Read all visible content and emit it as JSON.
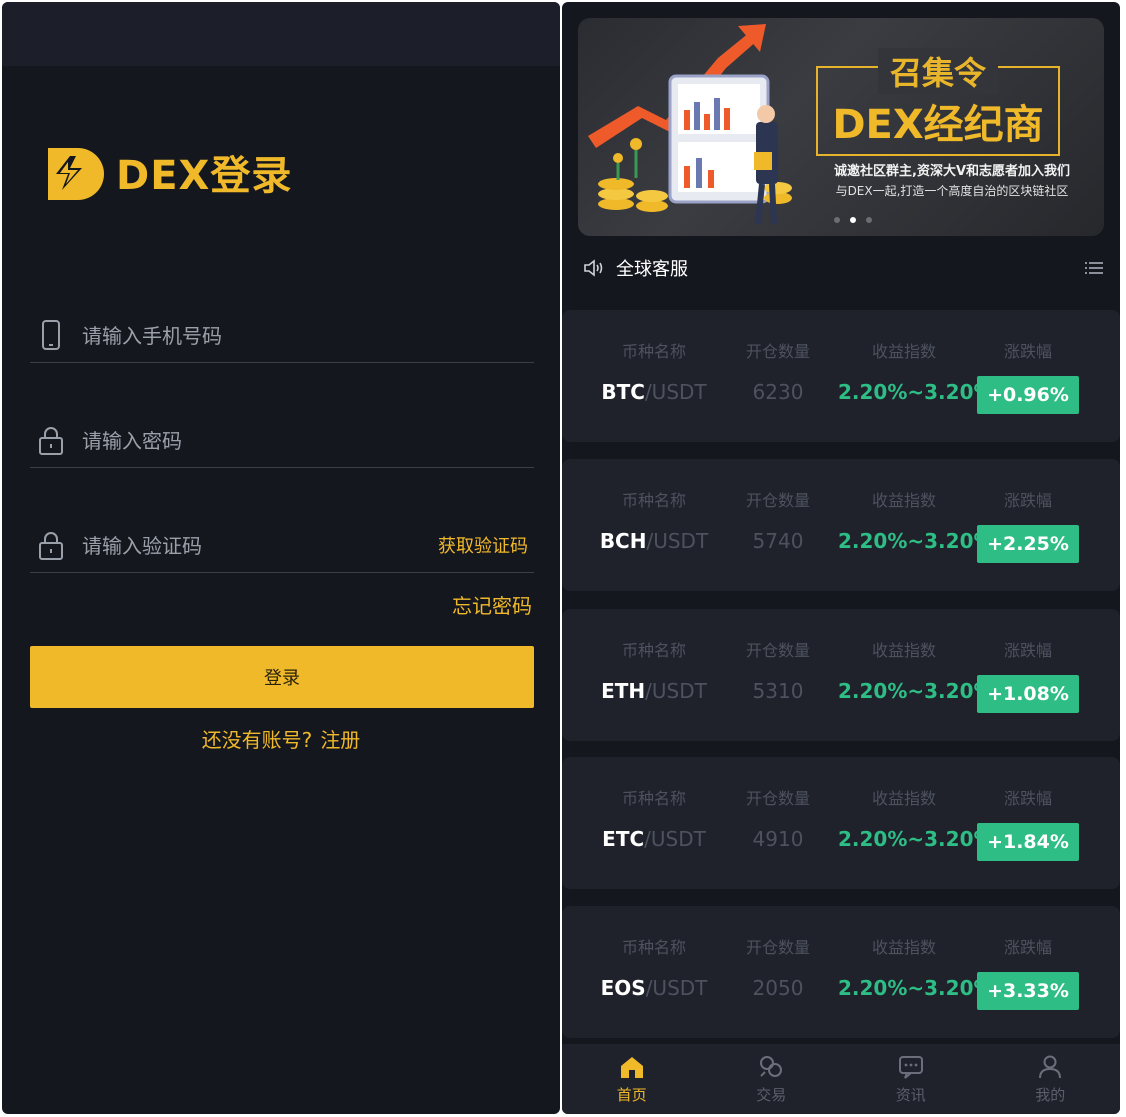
{
  "login": {
    "logo_text": "DEX登录",
    "phone_placeholder": "请输入手机号码",
    "password_placeholder": "请输入密码",
    "code_placeholder": "请输入验证码",
    "get_code": "获取验证码",
    "forgot_password": "忘记密码",
    "login_button": "登录",
    "no_account": "还没有账号?",
    "register": "注册"
  },
  "home": {
    "banner": {
      "title": "召集令",
      "main": "DEX经纪商",
      "sub1": "诚邀社区群主,资深大V和志愿者加入我们",
      "sub2": "与DEX一起,打造一个高度自治的区块链社区",
      "active_dot": 1
    },
    "notice": "全球客服",
    "headers": [
      "币种名称",
      "开仓数量",
      "收益指数",
      "涨跌幅"
    ],
    "markets": [
      {
        "base": "BTC",
        "quote": "/USDT",
        "qty": "6230",
        "range": "2.20%~3.20%",
        "change": "+0.96%"
      },
      {
        "base": "BCH",
        "quote": "/USDT",
        "qty": "5740",
        "range": "2.20%~3.20%",
        "change": "+2.25%"
      },
      {
        "base": "ETH",
        "quote": "/USDT",
        "qty": "5310",
        "range": "2.20%~3.20%",
        "change": "+1.08%"
      },
      {
        "base": "ETC",
        "quote": "/USDT",
        "qty": "4910",
        "range": "2.20%~3.20%",
        "change": "+1.84%"
      },
      {
        "base": "EOS",
        "quote": "/USDT",
        "qty": "2050",
        "range": "2.20%~3.20%",
        "change": "+3.33%"
      }
    ],
    "tabs": [
      {
        "label": "首页",
        "icon": "home-icon",
        "active": true
      },
      {
        "label": "交易",
        "icon": "trade-icon",
        "active": false
      },
      {
        "label": "资讯",
        "icon": "news-icon",
        "active": false
      },
      {
        "label": "我的",
        "icon": "user-icon",
        "active": false
      }
    ]
  },
  "colors": {
    "accent": "#f0b92a",
    "up": "#2ebd85",
    "bg": "#15171f",
    "card": "#1f222b"
  }
}
